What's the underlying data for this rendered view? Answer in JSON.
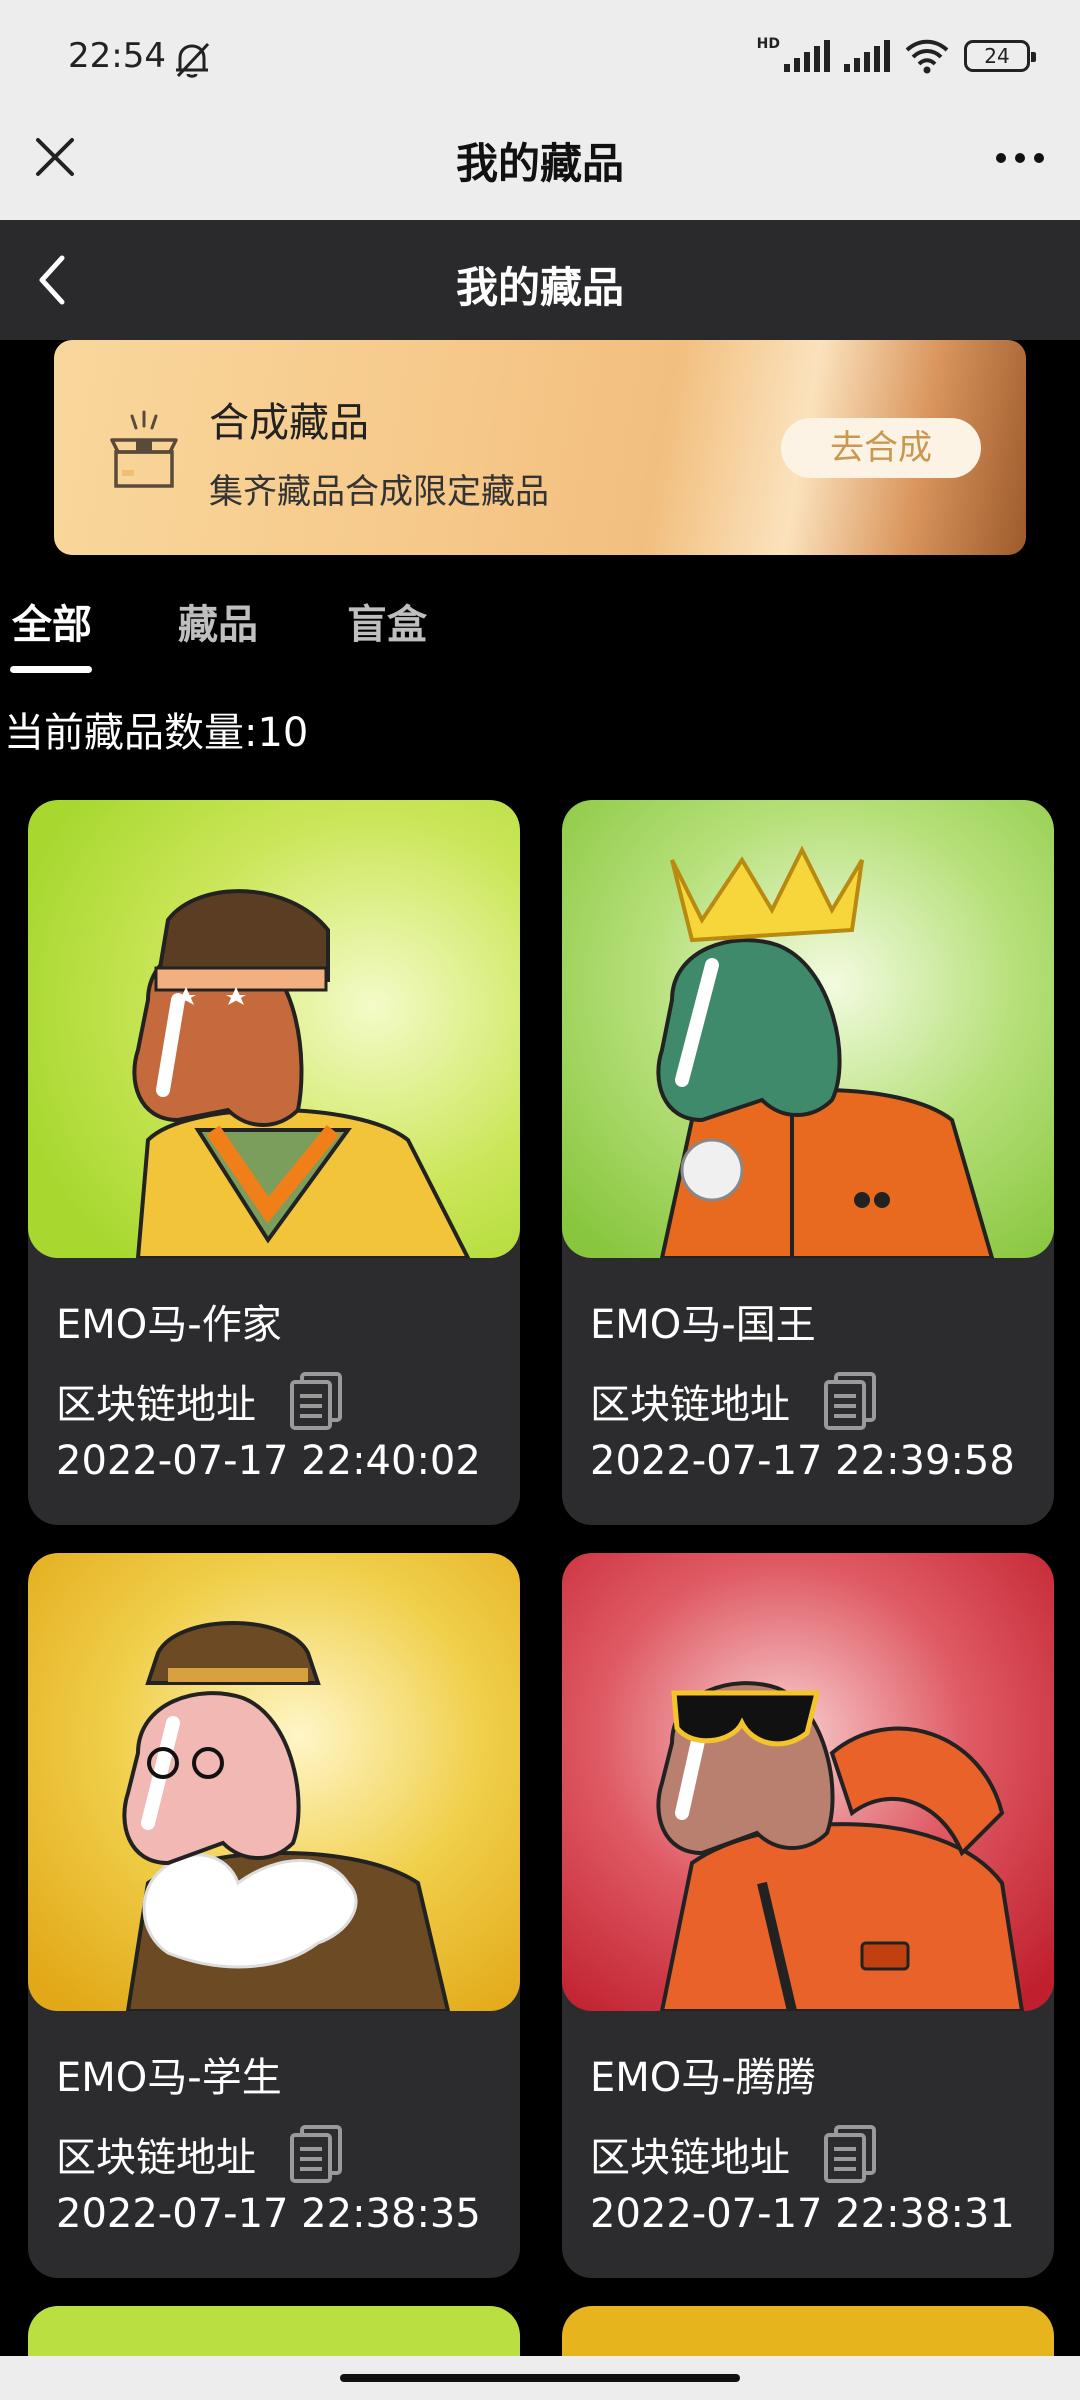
{
  "status_bar": {
    "time": "22:54",
    "network_label": "HD",
    "battery": "24"
  },
  "title_bar": {
    "title": "我的藏品",
    "close_icon": "close-icon",
    "more_icon": "more-icon"
  },
  "page_header": {
    "title": "我的藏品",
    "back_icon": "chevron-left-icon"
  },
  "banner": {
    "title": "合成藏品",
    "subtitle": "集齐藏品合成限定藏品",
    "button_label": "去合成",
    "icon": "gift-box-icon"
  },
  "tabs": [
    {
      "label": "全部",
      "active": true
    },
    {
      "label": "藏品",
      "active": false
    },
    {
      "label": "盲盒",
      "active": false
    }
  ],
  "collection_count": "当前藏品数量:10",
  "cards": [
    {
      "name": "EMO马-作家",
      "chain_label": "区块链地址",
      "date": "2022-07-17 22:40:02",
      "bg": "#b9e040"
    },
    {
      "name": "EMO马-国王",
      "chain_label": "区块链地址",
      "date": "2022-07-17 22:39:58",
      "bg": "#98d04c"
    },
    {
      "name": "EMO马-学生",
      "chain_label": "区块链地址",
      "date": "2022-07-17 22:38:35",
      "bg": "#e6b41c"
    },
    {
      "name": "EMO马-腾腾",
      "chain_label": "区块链地址",
      "date": "2022-07-17 22:38:31",
      "bg": "#c8253a"
    }
  ],
  "partial_cards": [
    {
      "bg": "#b9e040"
    },
    {
      "bg": "#e6b41c"
    }
  ]
}
